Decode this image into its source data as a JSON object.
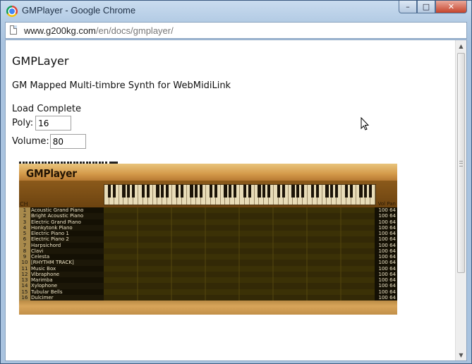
{
  "window": {
    "title": "GMPlayer - Google Chrome",
    "buttons": {
      "minimize": "–",
      "maximize": "□",
      "close": "✕"
    }
  },
  "address": {
    "host": "www.g200kg.com",
    "path": "/en/docs/gmplayer/"
  },
  "page": {
    "heading": "GMPLayer",
    "subtitle": "GM Mapped Multi-timbre Synth for WebMidiLink",
    "status": "Load Complete",
    "poly_label": "Poly:",
    "poly_value": "16",
    "volume_label": "Volume:",
    "volume_value": "80"
  },
  "synth": {
    "title": "GMPlayer",
    "ch_label": "CH",
    "volpan_label": "Vol Pan",
    "channels": [
      {
        "ch": "1",
        "program": "Acoustic Grand Piano",
        "vol": "100",
        "pan": "64"
      },
      {
        "ch": "2",
        "program": "Bright Acoustic Piano",
        "vol": "100",
        "pan": "64"
      },
      {
        "ch": "3",
        "program": "Electric Grand Piano",
        "vol": "100",
        "pan": "64"
      },
      {
        "ch": "4",
        "program": "Honkytonk Piano",
        "vol": "100",
        "pan": "64"
      },
      {
        "ch": "5",
        "program": "Electric Piano 1",
        "vol": "100",
        "pan": "64"
      },
      {
        "ch": "6",
        "program": "Electric Piano 2",
        "vol": "100",
        "pan": "64"
      },
      {
        "ch": "7",
        "program": "Harpsichord",
        "vol": "100",
        "pan": "64"
      },
      {
        "ch": "8",
        "program": "Clavi",
        "vol": "100",
        "pan": "64"
      },
      {
        "ch": "9",
        "program": "Celesta",
        "vol": "100",
        "pan": "64"
      },
      {
        "ch": "10",
        "program": "[RHYTHM TRACK]",
        "vol": "100",
        "pan": "64"
      },
      {
        "ch": "11",
        "program": "Music Box",
        "vol": "100",
        "pan": "64"
      },
      {
        "ch": "12",
        "program": "Vibraphone",
        "vol": "100",
        "pan": "64"
      },
      {
        "ch": "13",
        "program": "Marimba",
        "vol": "100",
        "pan": "64"
      },
      {
        "ch": "14",
        "program": "Xylophone",
        "vol": "100",
        "pan": "64"
      },
      {
        "ch": "15",
        "program": "Tubular Bells",
        "vol": "100",
        "pan": "64"
      },
      {
        "ch": "16",
        "program": "Dulcimer",
        "vol": "100",
        "pan": "64"
      }
    ]
  }
}
